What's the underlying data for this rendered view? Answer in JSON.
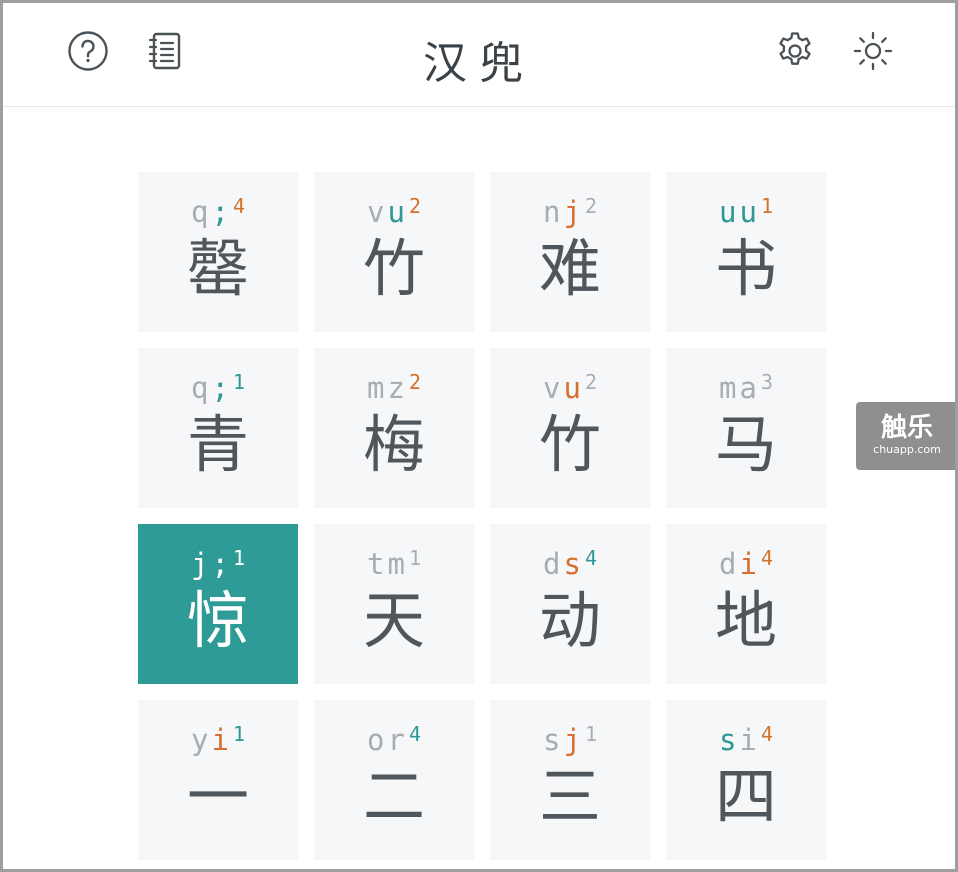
{
  "app": {
    "title": "汉兜"
  },
  "header": {
    "left_icons": [
      "help-icon",
      "notebook-icon"
    ],
    "right_icons": [
      "settings-icon",
      "theme-sun-icon"
    ]
  },
  "colors": {
    "exact": "#2e9993",
    "present": "#d86f2a",
    "absent": "#a9adb1",
    "selected_bg": "#2f9b97",
    "cell_bg": "#f5f7f9"
  },
  "grid": [
    [
      {
        "hanzi": "罄",
        "selected": false,
        "parts": [
          {
            "t": "q",
            "s": "absent"
          },
          {
            "t": ";",
            "s": "exact"
          }
        ],
        "tone": "4",
        "tone_s": "present"
      },
      {
        "hanzi": "竹",
        "selected": false,
        "parts": [
          {
            "t": "v",
            "s": "absent"
          },
          {
            "t": "u",
            "s": "exact"
          }
        ],
        "tone": "2",
        "tone_s": "present"
      },
      {
        "hanzi": "难",
        "selected": false,
        "parts": [
          {
            "t": "n",
            "s": "absent"
          },
          {
            "t": "j",
            "s": "present"
          }
        ],
        "tone": "2",
        "tone_s": "absent"
      },
      {
        "hanzi": "书",
        "selected": false,
        "parts": [
          {
            "t": "u",
            "s": "exact"
          },
          {
            "t": "u",
            "s": "exact"
          }
        ],
        "tone": "1",
        "tone_s": "present"
      }
    ],
    [
      {
        "hanzi": "青",
        "selected": false,
        "parts": [
          {
            "t": "q",
            "s": "absent"
          },
          {
            "t": ";",
            "s": "exact"
          }
        ],
        "tone": "1",
        "tone_s": "exact"
      },
      {
        "hanzi": "梅",
        "selected": false,
        "parts": [
          {
            "t": "m",
            "s": "absent"
          },
          {
            "t": "z",
            "s": "absent"
          }
        ],
        "tone": "2",
        "tone_s": "present"
      },
      {
        "hanzi": "竹",
        "selected": false,
        "parts": [
          {
            "t": "v",
            "s": "absent"
          },
          {
            "t": "u",
            "s": "present"
          }
        ],
        "tone": "2",
        "tone_s": "absent"
      },
      {
        "hanzi": "马",
        "selected": false,
        "parts": [
          {
            "t": "m",
            "s": "absent"
          },
          {
            "t": "a",
            "s": "absent"
          }
        ],
        "tone": "3",
        "tone_s": "absent"
      }
    ],
    [
      {
        "hanzi": "惊",
        "selected": true,
        "parts": [
          {
            "t": "j",
            "s": "white"
          },
          {
            "t": ";",
            "s": "white"
          }
        ],
        "tone": "1",
        "tone_s": "white"
      },
      {
        "hanzi": "天",
        "selected": false,
        "parts": [
          {
            "t": "t",
            "s": "absent"
          },
          {
            "t": "m",
            "s": "absent"
          }
        ],
        "tone": "1",
        "tone_s": "absent"
      },
      {
        "hanzi": "动",
        "selected": false,
        "parts": [
          {
            "t": "d",
            "s": "absent"
          },
          {
            "t": "s",
            "s": "present"
          }
        ],
        "tone": "4",
        "tone_s": "exact"
      },
      {
        "hanzi": "地",
        "selected": false,
        "parts": [
          {
            "t": "d",
            "s": "absent"
          },
          {
            "t": "i",
            "s": "present"
          }
        ],
        "tone": "4",
        "tone_s": "present"
      }
    ],
    [
      {
        "hanzi": "一",
        "selected": false,
        "parts": [
          {
            "t": "y",
            "s": "absent"
          },
          {
            "t": "i",
            "s": "present"
          }
        ],
        "tone": "1",
        "tone_s": "exact"
      },
      {
        "hanzi": "二",
        "selected": false,
        "parts": [
          {
            "t": "o",
            "s": "absent"
          },
          {
            "t": "r",
            "s": "absent"
          }
        ],
        "tone": "4",
        "tone_s": "exact"
      },
      {
        "hanzi": "三",
        "selected": false,
        "parts": [
          {
            "t": "s",
            "s": "absent"
          },
          {
            "t": "j",
            "s": "present"
          }
        ],
        "tone": "1",
        "tone_s": "absent"
      },
      {
        "hanzi": "四",
        "selected": false,
        "parts": [
          {
            "t": "s",
            "s": "exact"
          },
          {
            "t": "i",
            "s": "absent"
          }
        ],
        "tone": "4",
        "tone_s": "present"
      }
    ]
  ],
  "watermark": {
    "main": "触乐",
    "sub": "chuapp.com"
  }
}
